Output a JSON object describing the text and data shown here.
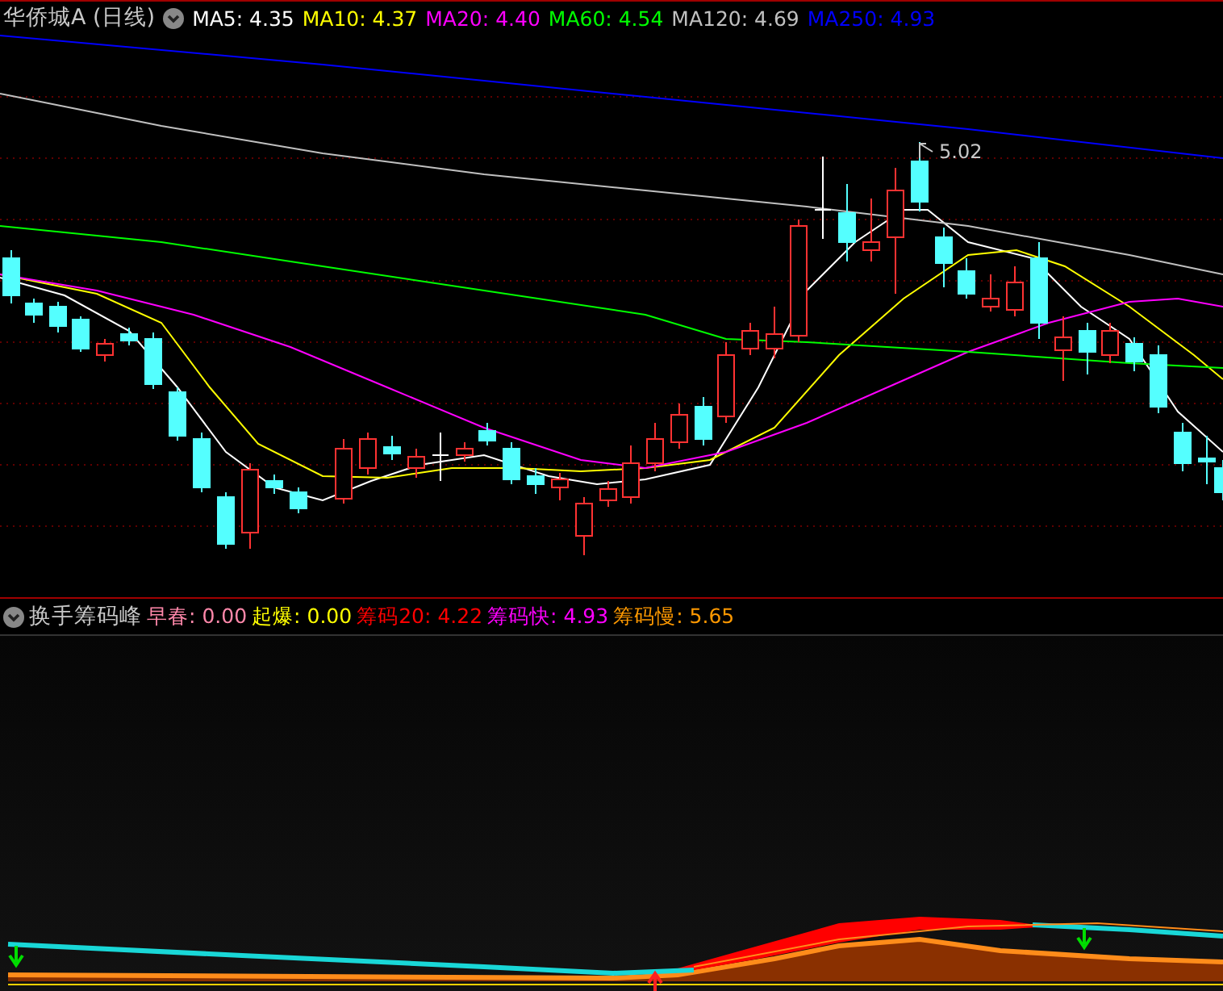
{
  "price_panel": {
    "title": "华侨城A (日线)",
    "indicators": [
      {
        "text": "MA5: 4.35",
        "color": "#ffffff"
      },
      {
        "text": "MA10: 4.37",
        "color": "#ffff00"
      },
      {
        "text": "MA20: 4.40",
        "color": "#ff00ff"
      },
      {
        "text": "MA60: 4.54",
        "color": "#00ff00"
      },
      {
        "text": "MA120: 4.69",
        "color": "#c0c0c0"
      },
      {
        "text": "MA250: 4.93",
        "color": "#0000ff"
      }
    ],
    "peak_label": "5.02"
  },
  "indicator_panel": {
    "title": "换手筹码峰",
    "indicators": [
      {
        "label": "早春:",
        "value": "0.00",
        "color": "#ff88aa"
      },
      {
        "label": "起爆:",
        "value": "0.00",
        "color": "#ffff00"
      },
      {
        "label": "筹码20:",
        "value": "4.22",
        "color": "#ff0000"
      },
      {
        "label": "筹码快:",
        "value": "4.93",
        "color": "#ff00ff"
      },
      {
        "label": "筹码慢:",
        "value": "5.65",
        "color": "#ff9900"
      }
    ]
  }
}
